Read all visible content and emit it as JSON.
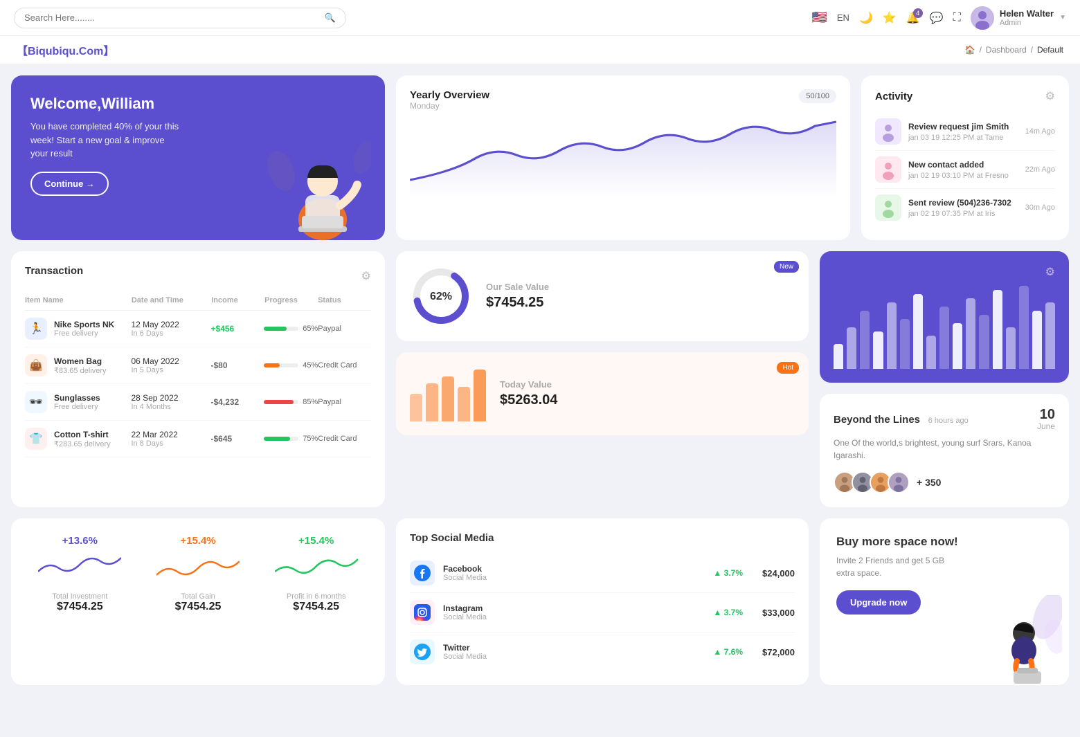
{
  "topnav": {
    "search_placeholder": "Search Here........",
    "lang": "EN",
    "user": {
      "name": "Helen Walter",
      "role": "Admin"
    },
    "notification_count": "4"
  },
  "breadcrumb": {
    "brand": "【Biqubiqu.Com】",
    "home": "🏠",
    "separator": "/",
    "dashboard": "Dashboard",
    "current": "Default"
  },
  "welcome": {
    "title": "Welcome,William",
    "subtitle": "You have completed 40% of your this week! Start a new goal & improve your result",
    "button": "Continue →"
  },
  "yearly_overview": {
    "title": "Yearly Overview",
    "subtitle": "Monday",
    "badge": "50/100"
  },
  "activity": {
    "title": "Activity",
    "items": [
      {
        "title": "Review request jim Smith",
        "subtitle": "jan 03 19 12:25 PM at Tame",
        "time": "14m Ago"
      },
      {
        "title": "New contact added",
        "subtitle": "jan 02 19 03:10 PM at Fresno",
        "time": "22m Ago"
      },
      {
        "title": "Sent review (504)236-7302",
        "subtitle": "jan 02 19 07:35 PM at Iris",
        "time": "30m Ago"
      }
    ]
  },
  "transaction": {
    "title": "Transaction",
    "columns": [
      "Item Name",
      "Date and Time",
      "Income",
      "Progress",
      "Status"
    ],
    "rows": [
      {
        "icon": "🏃",
        "name": "Nike Sports NK",
        "sub": "Free delivery",
        "date": "12 May 2022",
        "days": "In 6 Days",
        "income": "+$456",
        "income_type": "pos",
        "progress": 65,
        "progress_color": "#22c55e",
        "status": "Paypal"
      },
      {
        "icon": "👜",
        "name": "Women Bag",
        "sub": "₹83.65 delivery",
        "date": "06 May 2022",
        "days": "In 5 Days",
        "income": "-$80",
        "income_type": "neg",
        "progress": 45,
        "progress_color": "#f97316",
        "status": "Credit Card"
      },
      {
        "icon": "🕶",
        "name": "Sunglasses",
        "sub": "Free delivery",
        "date": "28 Sep 2022",
        "days": "In 4 Months",
        "income": "-$4,232",
        "income_type": "neg",
        "progress": 85,
        "progress_color": "#ef4444",
        "status": "Paypal"
      },
      {
        "icon": "👕",
        "name": "Cotton T-shirt",
        "sub": "₹283.65 delivery",
        "date": "22 Mar 2022",
        "days": "In 8 Days",
        "income": "-$645",
        "income_type": "neg",
        "progress": 75,
        "progress_color": "#22c55e",
        "status": "Credit Card"
      }
    ]
  },
  "sale_cards": [
    {
      "badge": "New",
      "badge_type": "new",
      "label": "Our Sale Value",
      "value": "$7454.25",
      "percent": 62
    },
    {
      "badge": "Hot",
      "badge_type": "hot",
      "label": "Today Value",
      "value": "$5263.04",
      "percent": 55
    }
  ],
  "bar_chart": {
    "bars": [
      30,
      50,
      70,
      45,
      80,
      60,
      90,
      40,
      75,
      55,
      85,
      65,
      95,
      50,
      100,
      70,
      80
    ]
  },
  "beyond": {
    "title": "Beyond the Lines",
    "time": "6 hours ago",
    "description": "One Of the world,s brightest, young surf Srars, Kanoa Igarashi.",
    "count": "+ 350",
    "date": "10",
    "month": "June"
  },
  "mini_stats": [
    {
      "pct": "+13.6%",
      "pct_color": "#5b4fcf",
      "label": "Total Investment",
      "value": "$7454.25",
      "wave_color": "#5b4fcf"
    },
    {
      "pct": "+15.4%",
      "pct_color": "#f97316",
      "label": "Total Gain",
      "value": "$7454.25",
      "wave_color": "#f97316"
    },
    {
      "pct": "+15.4%",
      "pct_color": "#22c55e",
      "label": "Profit in 6 months",
      "value": "$7454.25",
      "wave_color": "#22c55e"
    }
  ],
  "social_media": {
    "title": "Top Social Media",
    "items": [
      {
        "name": "Facebook",
        "sub": "Social Media",
        "icon": "fb",
        "pct": "3.7%",
        "amount": "$24,000"
      },
      {
        "name": "Instagram",
        "sub": "Social Media",
        "icon": "ig",
        "pct": "3.7%",
        "amount": "$33,000"
      },
      {
        "name": "Twitter",
        "sub": "Social Media",
        "icon": "tw",
        "pct": "7.6%",
        "amount": "$72,000"
      }
    ]
  },
  "upgrade": {
    "title": "Buy more space now!",
    "description": "Invite 2 Friends and get 5 GB extra space.",
    "button": "Upgrade now"
  }
}
